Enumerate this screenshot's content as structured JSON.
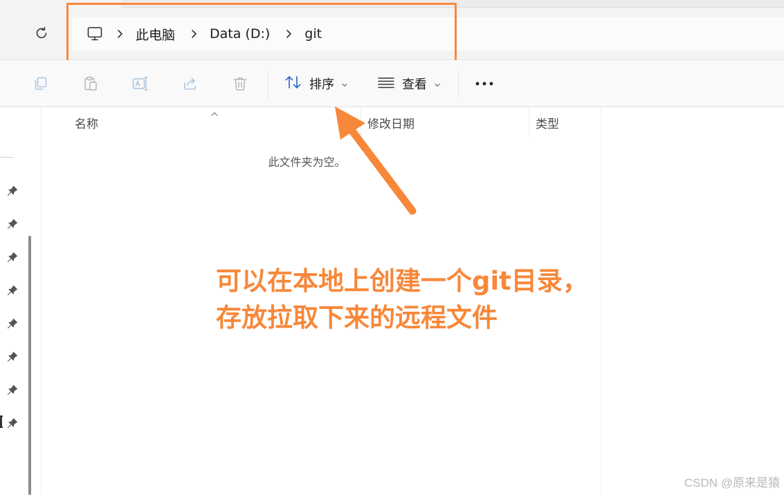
{
  "address": {
    "crumbs": [
      "此电脑",
      "Data (D:)",
      "git"
    ],
    "pc_icon": "monitor-icon",
    "separator_icon": "chevron-right-icon",
    "refresh_icon": "refresh-icon"
  },
  "toolbar": {
    "icons": [
      "copy-icon",
      "paste-icon",
      "rename-icon",
      "share-icon",
      "delete-icon"
    ],
    "sort_label": "排序",
    "view_label": "查看",
    "more_icon": "more-icon"
  },
  "columns": {
    "name": "名称",
    "modified": "修改日期",
    "type": "类型"
  },
  "empty_message": "此文件夹为空。",
  "annotation": {
    "line1": "可以在本地上创建一个git目录，",
    "line2": "存放拉取下来的远程文件"
  },
  "watermark": "CSDN @原来是猿",
  "colors": {
    "annotation": "#f7883a",
    "highlight_border": "#f7883a",
    "sort_icon_blue": "#2b6cc4"
  }
}
